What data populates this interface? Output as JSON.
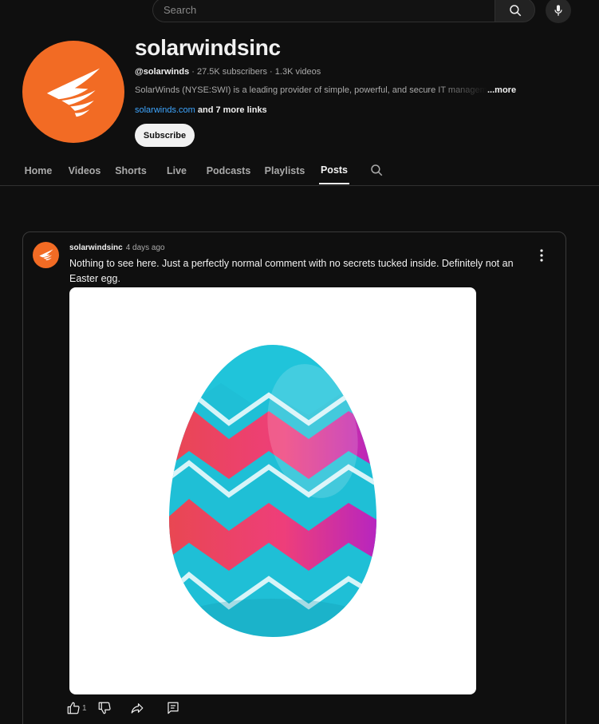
{
  "search": {
    "placeholder": "Search"
  },
  "channel": {
    "name": "solarwindsinc",
    "handle": "@solarwinds",
    "stats": " · 27.5K subscribers · 1.3K videos",
    "description": "SolarWinds (NYSE:SWI) is a leading provider of simple, powerful, and secure IT management",
    "more_label": "...more",
    "link": "solarwinds.com",
    "more_links": " and 7 more links",
    "subscribe_label": "Subscribe",
    "brand_color": "#f26b24"
  },
  "tabs": [
    {
      "label": "Home",
      "active": false
    },
    {
      "label": "Videos",
      "active": false
    },
    {
      "label": "Shorts",
      "active": false
    },
    {
      "label": "Live",
      "active": false
    },
    {
      "label": "Podcasts",
      "active": false
    },
    {
      "label": "Playlists",
      "active": false
    },
    {
      "label": "Posts",
      "active": true
    }
  ],
  "post": {
    "author": "solarwindsinc",
    "time": "4 days ago",
    "text": "Nothing to see here. Just a perfectly normal comment with no secrets tucked inside. Definitely not an Easter egg.",
    "like_count": "1",
    "image_subject": "easter-egg-illustration",
    "egg_colors": {
      "base": "#1fbfd6",
      "band": "#ee3e7a",
      "band_edge": "#c024c4",
      "zigzag": "#d8f4f8"
    }
  },
  "icons": [
    "search-icon",
    "mic-icon",
    "solarwinds-logo",
    "kebab-menu-icon",
    "thumbs-up-icon",
    "thumbs-down-icon",
    "share-icon",
    "comment-icon"
  ]
}
